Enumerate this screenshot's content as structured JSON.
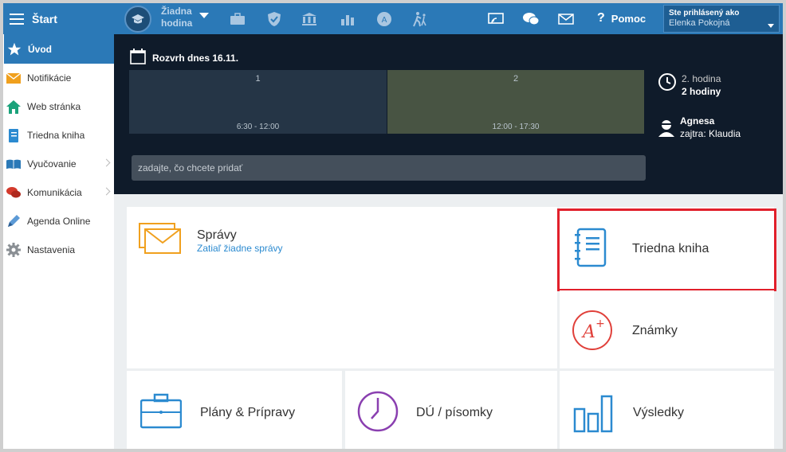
{
  "topbar": {
    "start_label": "Štart",
    "lesson_label_line1": "Žiadna",
    "lesson_label_line2": "hodina",
    "help_label": "Pomoc",
    "user_caption": "Ste prihlásený ako",
    "user_name": "Elenka Pokojná"
  },
  "sidebar": {
    "items": [
      {
        "label": "Úvod",
        "icon": "star-icon"
      },
      {
        "label": "Notifikácie",
        "icon": "envelope-icon"
      },
      {
        "label": "Web stránka",
        "icon": "home-icon"
      },
      {
        "label": "Triedna kniha",
        "icon": "notebook-icon"
      },
      {
        "label": "Vyučovanie",
        "icon": "book-icon"
      },
      {
        "label": "Komunikácia",
        "icon": "chat-icon"
      },
      {
        "label": "Agenda Online",
        "icon": "pencil-icon"
      },
      {
        "label": "Nastavenia",
        "icon": "gear-icon"
      }
    ]
  },
  "schedule": {
    "title": "Rozvrh dnes 16.11.",
    "slots": [
      {
        "number": "1",
        "time": "6:30 - 12:00"
      },
      {
        "number": "2",
        "time": "12:00 - 17:30"
      }
    ],
    "current_lesson_line1": "2. hodina",
    "current_lesson_line2": "2 hodiny",
    "substitute_name": "Agnesa",
    "substitute_tomorrow": "zajtra: Klaudia",
    "add_placeholder": "zadajte, čo chcete pridať"
  },
  "tiles": {
    "messages_label": "Správy",
    "messages_sub": "Zatiaľ žiadne správy",
    "classbook_label": "Triedna kniha",
    "grades_label": "Známky",
    "plans_label": "Plány & Prípravy",
    "homework_label": "DÚ / písomky",
    "results_label": "Výsledky"
  },
  "colors": {
    "brand": "#2b79b7",
    "dark_panel": "#0f1b2a",
    "highlight": "#e1202b",
    "slot1": "#253546",
    "slot2": "#485443"
  }
}
